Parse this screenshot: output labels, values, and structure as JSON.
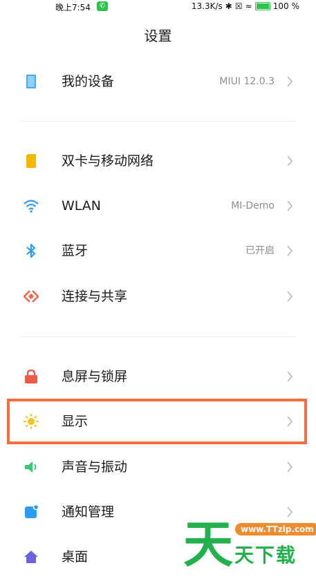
{
  "status_bar": {
    "time": "晚上7:54",
    "network_speed": "13.3K/s",
    "battery": "100"
  },
  "page_title": "设置",
  "rows": [
    {
      "label": "我的设备",
      "value": "MIUI 12.0.3",
      "icon": "device-icon"
    },
    {
      "label": "双卡与移动网络",
      "value": "",
      "icon": "sim-card-icon"
    },
    {
      "label": "WLAN",
      "value": "MI-Demo",
      "icon": "wifi-icon"
    },
    {
      "label": "蓝牙",
      "value": "已开启",
      "icon": "bluetooth-icon"
    },
    {
      "label": "连接与共享",
      "value": "",
      "icon": "share-icon"
    },
    {
      "label": "息屏与锁屏",
      "value": "",
      "icon": "lock-icon"
    },
    {
      "label": "显示",
      "value": "",
      "icon": "sun-icon"
    },
    {
      "label": "声音与振动",
      "value": "",
      "icon": "speaker-icon"
    },
    {
      "label": "通知管理",
      "value": "",
      "icon": "notification-icon"
    },
    {
      "label": "桌面",
      "value": "",
      "icon": "home-icon"
    }
  ],
  "watermark": {
    "big_char": "天",
    "url": "www.TTzip.com",
    "text": "天下载"
  },
  "colors": {
    "highlight": "#f26e3f",
    "accent_blue": "#2d9cf0",
    "watermark_green": "#22b14c"
  }
}
